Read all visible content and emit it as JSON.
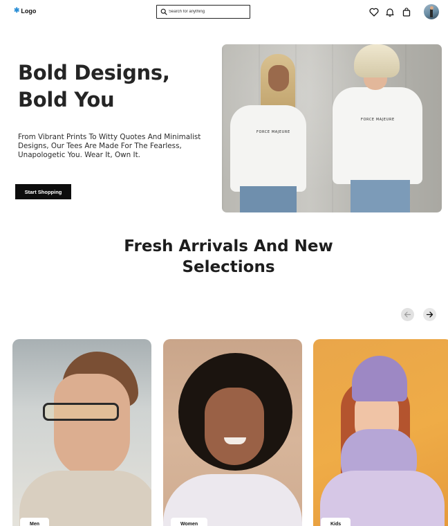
{
  "header": {
    "logo_text": "Logo",
    "logo_mark": "✱",
    "search_placeholder": "Search for anything",
    "icons": [
      "search-icon",
      "heart-icon",
      "bell-icon",
      "shopping-bag-icon"
    ]
  },
  "hero": {
    "title_line1": "Bold Designs,",
    "title_line2": "Bold You",
    "subtitle": "From Vibrant Prints To Witty Quotes And Minimalist Designs, Our Tees Are Made For The Fearless, Unapologetic You. Wear It, Own It.",
    "cta_label": "Start Shopping",
    "shirt_print_1": "FORCE MAJEURE",
    "shirt_print_2": "FORCE MAJEURE"
  },
  "section": {
    "title_line1": "Fresh Arrivals And New",
    "title_line2": "Selections"
  },
  "categories": [
    {
      "label": "Men"
    },
    {
      "label": "Women"
    },
    {
      "label": "Kids"
    }
  ],
  "colors": {
    "accent": "#2b8fd6",
    "button_bg": "#0d0d0d",
    "text": "#252525"
  }
}
